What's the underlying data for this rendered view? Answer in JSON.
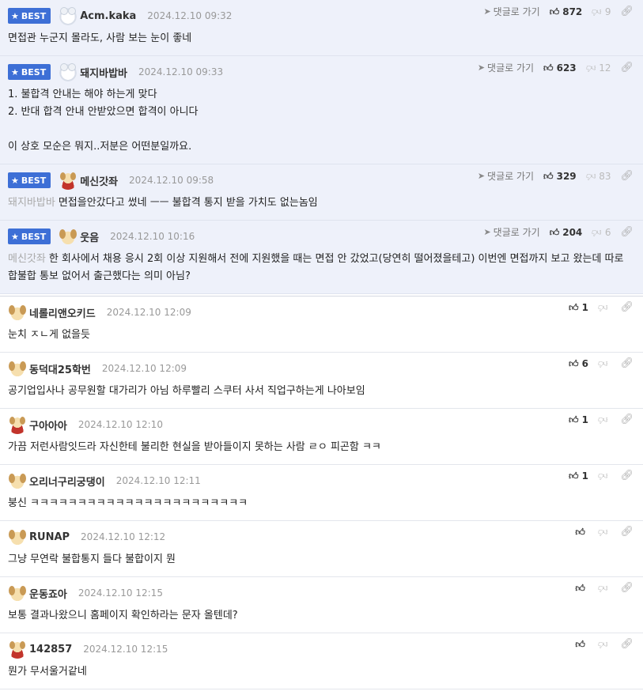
{
  "labels": {
    "best": "BEST",
    "goto": "댓글로 가기"
  },
  "best_comments": [
    {
      "author": "Acm.kaka",
      "avatar": "bear",
      "date": "2024.12.10 09:32",
      "up": "872",
      "down": "9",
      "mention": "",
      "text": "면접관 누군지 몰라도, 사람 보는 눈이 좋네"
    },
    {
      "author": "돼지바밥바",
      "avatar": "bear",
      "date": "2024.12.10 09:33",
      "up": "623",
      "down": "12",
      "mention": "",
      "text": "1. 불합격 안내는 해야 하는게 맞다\n2. 반대 합격 안내 안받았으면 합격이 아니다\n\n이 상호 모순은 뭐지..저분은 어떤분일까요."
    },
    {
      "author": "메신갓좌",
      "avatar": "cape",
      "date": "2024.12.10 09:58",
      "up": "329",
      "down": "83",
      "mention": "돼지바밥바",
      "text": "면접을안갔다고 썼네 ㅡㅡ 불합격 통지 받을 가치도 없는놈임"
    },
    {
      "author": "웃음",
      "avatar": "dog",
      "date": "2024.12.10 10:16",
      "up": "204",
      "down": "6",
      "mention": "메신갓좌",
      "text": "한 회사에서 채용 응시 2회 이상 지원해서 전에 지원했을 때는 면접 안 갔었고(당연히 떨어졌을테고) 이번엔 면접까지 보고 왔는데 따로 합불합 통보 없어서 출근했다는 의미 아님?"
    }
  ],
  "comments": [
    {
      "author": "네롤리앤오키드",
      "avatar": "dog",
      "date": "2024.12.10 12:09",
      "up": "1",
      "text": "눈치 ㅈㄴ게 없을듯"
    },
    {
      "author": "동덕대25학번",
      "avatar": "dog",
      "date": "2024.12.10 12:09",
      "up": "6",
      "text": "공기업입사나 공무원할 대가리가 아님 하루빨리 스쿠터 사서 직업구하는게 나아보임"
    },
    {
      "author": "구아아아",
      "avatar": "cape",
      "date": "2024.12.10 12:10",
      "up": "1",
      "text": "가끔 저런사람잇드라 자신한테 불리한 현실을 받아들이지 못하는 사람 ㄹㅇ 피곤함 ㅋㅋ"
    },
    {
      "author": "오리너구리궁댕이",
      "avatar": "dog",
      "date": "2024.12.10 12:11",
      "up": "1",
      "text": "붕신 ㅋㅋㅋㅋㅋㅋㅋㅋㅋㅋㅋㅋㅋㅋㅋㅋㅋㅋㅋㅋㅋㅋㅋ"
    },
    {
      "author": "RUNAP",
      "avatar": "dog",
      "date": "2024.12.10 12:12",
      "up": "",
      "text": "그냥 무연락 불합통지 들다 불합이지 뭔"
    },
    {
      "author": "운동죠아",
      "avatar": "dog",
      "date": "2024.12.10 12:15",
      "up": "",
      "text": "보통 결과나왔으니 홈페이지 확인하라는 문자 올텐데?"
    },
    {
      "author": "142857",
      "avatar": "cape",
      "date": "2024.12.10 12:15",
      "up": "",
      "text": "뭔가 무서울거같네"
    }
  ],
  "colors": {
    "best_bg": "#eef1fa",
    "badge": "#3d6fd6",
    "mention": "#aaaaaa"
  },
  "icons": {
    "best_star": "star-icon",
    "goto": "arrow-icon",
    "up": "thumbs-up-icon",
    "down": "thumbs-down-icon",
    "link": "link-icon"
  }
}
